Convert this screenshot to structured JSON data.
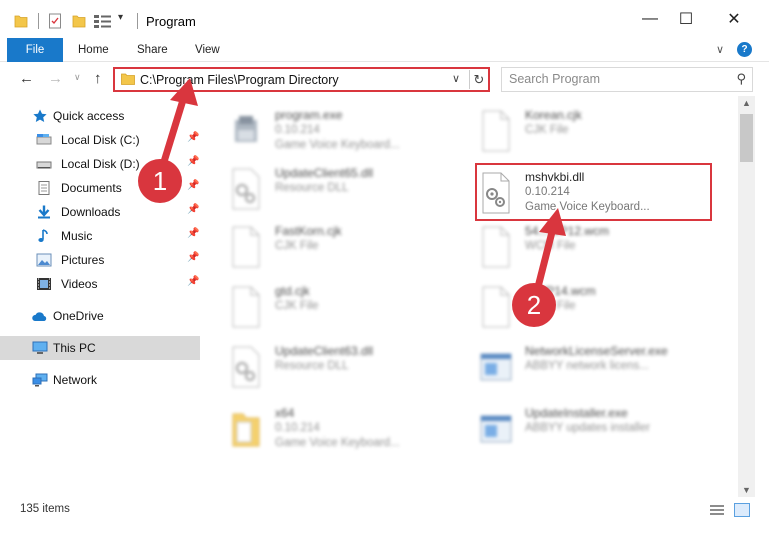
{
  "window": {
    "title": "Program",
    "minimize_glyph": "—",
    "maximize_glyph": "☐",
    "close_glyph": "✕"
  },
  "quick_access_toolbar": {
    "dropdown_glyph": "▾",
    "icons": [
      "folder-icon",
      "properties-icon",
      "new-folder-icon",
      "view-icon"
    ]
  },
  "ribbon": {
    "tabs": [
      {
        "label": "File"
      },
      {
        "label": "Home"
      },
      {
        "label": "Share"
      },
      {
        "label": "View"
      }
    ],
    "expand_glyph": "∨",
    "help_glyph": "?"
  },
  "navigation": {
    "back_glyph": "←",
    "forward_glyph": "→",
    "recent_glyph": "∨",
    "up_glyph": "↑"
  },
  "address_bar": {
    "path": "C:\\Program Files\\Program Directory",
    "dropdown_glyph": "∨",
    "refresh_glyph": "↻"
  },
  "search": {
    "placeholder": "Search Program",
    "icon_glyph": "⚲"
  },
  "nav_pane": {
    "items": [
      {
        "label": "Quick access",
        "icon": "star-icon"
      },
      {
        "label": "Local Disk (C:)",
        "icon": "drive-icon",
        "pinned": true
      },
      {
        "label": "Local Disk (D:)",
        "icon": "drive-icon",
        "pinned": true
      },
      {
        "label": "Documents",
        "icon": "document-icon",
        "pinned": true
      },
      {
        "label": "Downloads",
        "icon": "download-icon",
        "pinned": true
      },
      {
        "label": "Music",
        "icon": "music-icon",
        "pinned": true
      },
      {
        "label": "Pictures",
        "icon": "picture-icon",
        "pinned": true
      },
      {
        "label": "Videos",
        "icon": "video-icon",
        "pinned": true
      },
      {
        "label": "OneDrive",
        "icon": "cloud-icon"
      },
      {
        "label": "This PC",
        "icon": "computer-icon",
        "selected": true
      },
      {
        "label": "Network",
        "icon": "network-icon"
      }
    ],
    "pin_glyph": "📌"
  },
  "files": [
    {
      "name": "program.exe",
      "line2": "0.10.214",
      "line3": "Game Voice Keyboard...",
      "icon": "exe-icon"
    },
    {
      "name": "Korean.cjk",
      "line2": "CJK File",
      "line3": "",
      "icon": "file-icon"
    },
    {
      "name": "UpdateClient65.dll",
      "line2": "Resource DLL",
      "line3": "",
      "icon": "dll-icon"
    },
    {
      "name": "mshvkbi.dll",
      "line2": "0.10.214",
      "line3": "Game Voice Keyboard...",
      "icon": "dll-icon",
      "highlighted": true
    },
    {
      "name": "FastKorn.cjk",
      "line2": "CJK File",
      "line3": "",
      "icon": "file-icon"
    },
    {
      "name": "54...WP12.wcm",
      "line2": "WCM File",
      "line3": "",
      "icon": "file-icon"
    },
    {
      "name": "gtd.cjk",
      "line2": "CJK File",
      "line3": "",
      "icon": "file-icon"
    },
    {
      "name": "...WP14.wcm",
      "line2": "WCM File",
      "line3": "",
      "icon": "file-icon"
    },
    {
      "name": "UpdateClient63.dll",
      "line2": "Resource DLL",
      "line3": "",
      "icon": "dll-icon"
    },
    {
      "name": "NetworkLicenseServer.exe",
      "line2": "ABBYY network licens...",
      "line3": "",
      "icon": "app-icon"
    },
    {
      "name": "x64",
      "line2": "0.10.214",
      "line3": "Game Voice Keyboard...",
      "icon": "folder-icon"
    },
    {
      "name": "UpdateInstaller.exe",
      "line2": "ABBYY updates installer",
      "line3": "",
      "icon": "app-icon"
    }
  ],
  "status": {
    "item_count": "135 items"
  },
  "annotations": {
    "marker_1": "1",
    "marker_2": "2",
    "color": "#d9363e"
  },
  "colors": {
    "accent": "#1979ca",
    "highlight": "#d9363e",
    "selected_nav": "#d9d9d9"
  }
}
